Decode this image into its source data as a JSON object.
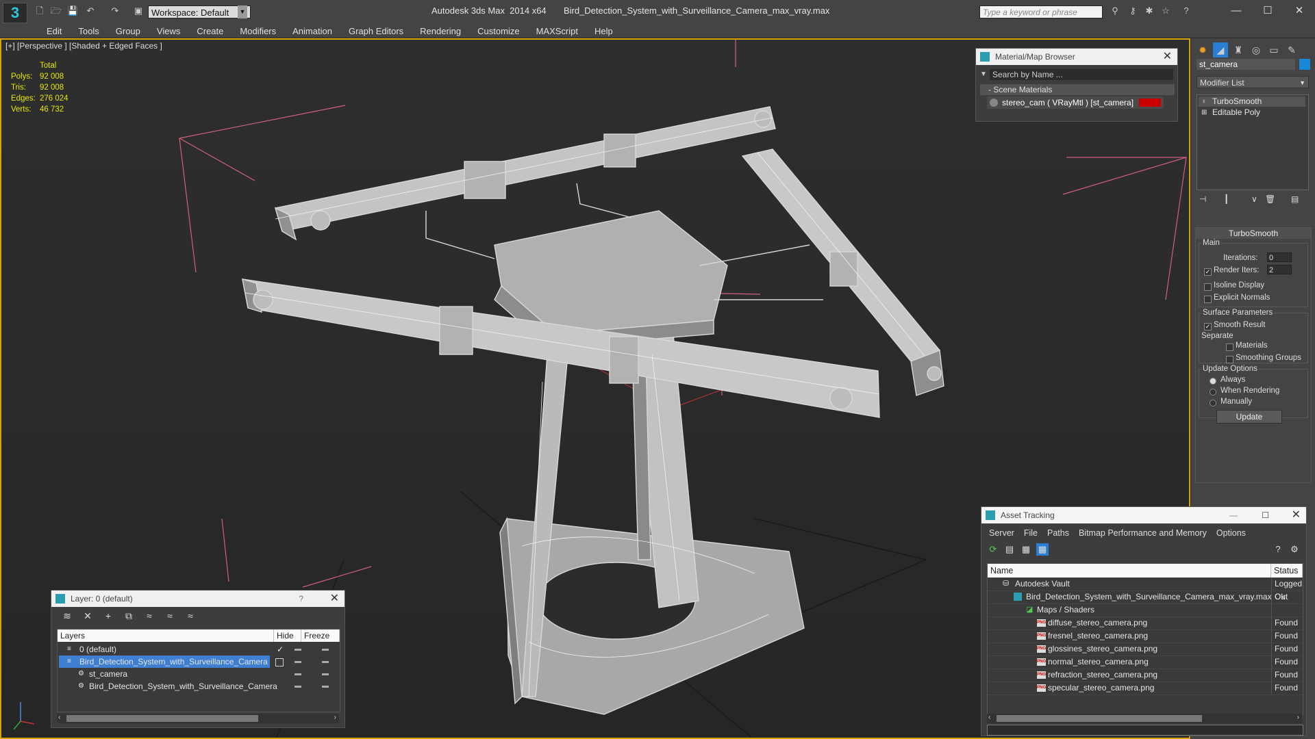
{
  "titlebar": {
    "workspace": "Workspace: Default",
    "title": "Autodesk 3ds Max  2014 x64       Bird_Detection_System_with_Surveillance_Camera_max_vray.max",
    "search_placeholder": "Type a keyword or phrase",
    "minimize": "—",
    "maximize": "☐",
    "close": "✕"
  },
  "menu": [
    "Edit",
    "Tools",
    "Group",
    "Views",
    "Create",
    "Modifiers",
    "Animation",
    "Graph Editors",
    "Rendering",
    "Customize",
    "MAXScript",
    "Help"
  ],
  "viewport": {
    "label": "[+] [Perspective ] [Shaded + Edged Faces ]",
    "stats": {
      "header": "Total",
      "rows": [
        {
          "label": "Polys:",
          "value": "92 008"
        },
        {
          "label": "Tris:",
          "value": "92 008"
        },
        {
          "label": "Edges:",
          "value": "276 024"
        },
        {
          "label": "Verts:",
          "value": "46 732"
        }
      ]
    }
  },
  "material_browser": {
    "title": "Material/Map Browser",
    "search": "Search by Name ...",
    "section": "- Scene Materials",
    "item": "stereo_cam  ( VRayMtl ) [st_camera]",
    "swatch_color": "#cc0000"
  },
  "command_panel": {
    "object_name": "st_camera",
    "object_color": "#1a88d8",
    "modifier_list": "Modifier List",
    "stack": [
      "TurboSmooth",
      "Editable Poly"
    ],
    "turbosmooth": {
      "title": "TurboSmooth",
      "main": "Main",
      "iterations_label": "Iterations:",
      "iterations": "0",
      "render_iters_label": "Render Iters:",
      "render_iters": "2",
      "isoline": "Isoline Display",
      "explicit_normals": "Explicit Normals",
      "surface_params": "Surface Parameters",
      "smooth_result": "Smooth Result",
      "separate": "Separate",
      "materials": "Materials",
      "smoothing_groups": "Smoothing Groups",
      "update_options": "Update Options",
      "always": "Always",
      "when_rendering": "When Rendering",
      "manually": "Manually",
      "update_button": "Update"
    }
  },
  "layers": {
    "title": "Layer: 0 (default)",
    "help": "?",
    "close": "✕",
    "col_layers": "Layers",
    "col_hide": "Hide",
    "col_freeze": "Freeze",
    "rows": [
      {
        "name": "0 (default)"
      },
      {
        "name": "Bird_Detection_System_with_Surveillance_Camera"
      },
      {
        "name": "st_camera"
      },
      {
        "name": "Bird_Detection_System_with_Surveillance_Camera"
      }
    ]
  },
  "asset_tracking": {
    "title": "Asset Tracking",
    "menu": [
      "Server",
      "File",
      "Paths",
      "Bitmap Performance and Memory",
      "Options"
    ],
    "col_name": "Name",
    "col_status": "Status",
    "rows": [
      {
        "name": "Autodesk Vault",
        "status": "Logged Out"
      },
      {
        "name": "Bird_Detection_System_with_Surveillance_Camera_max_vray.max",
        "status": "Ok"
      },
      {
        "name": "Maps / Shaders",
        "status": ""
      },
      {
        "name": "diffuse_stereo_camera.png",
        "status": "Found"
      },
      {
        "name": "fresnel_stereo_camera.png",
        "status": "Found"
      },
      {
        "name": "glossines_stereo_camera.png",
        "status": "Found"
      },
      {
        "name": "normal_stereo_camera.png",
        "status": "Found"
      },
      {
        "name": "refraction_stereo_camera.png",
        "status": "Found"
      },
      {
        "name": "specular_stereo_camera.png",
        "status": "Found"
      }
    ]
  }
}
